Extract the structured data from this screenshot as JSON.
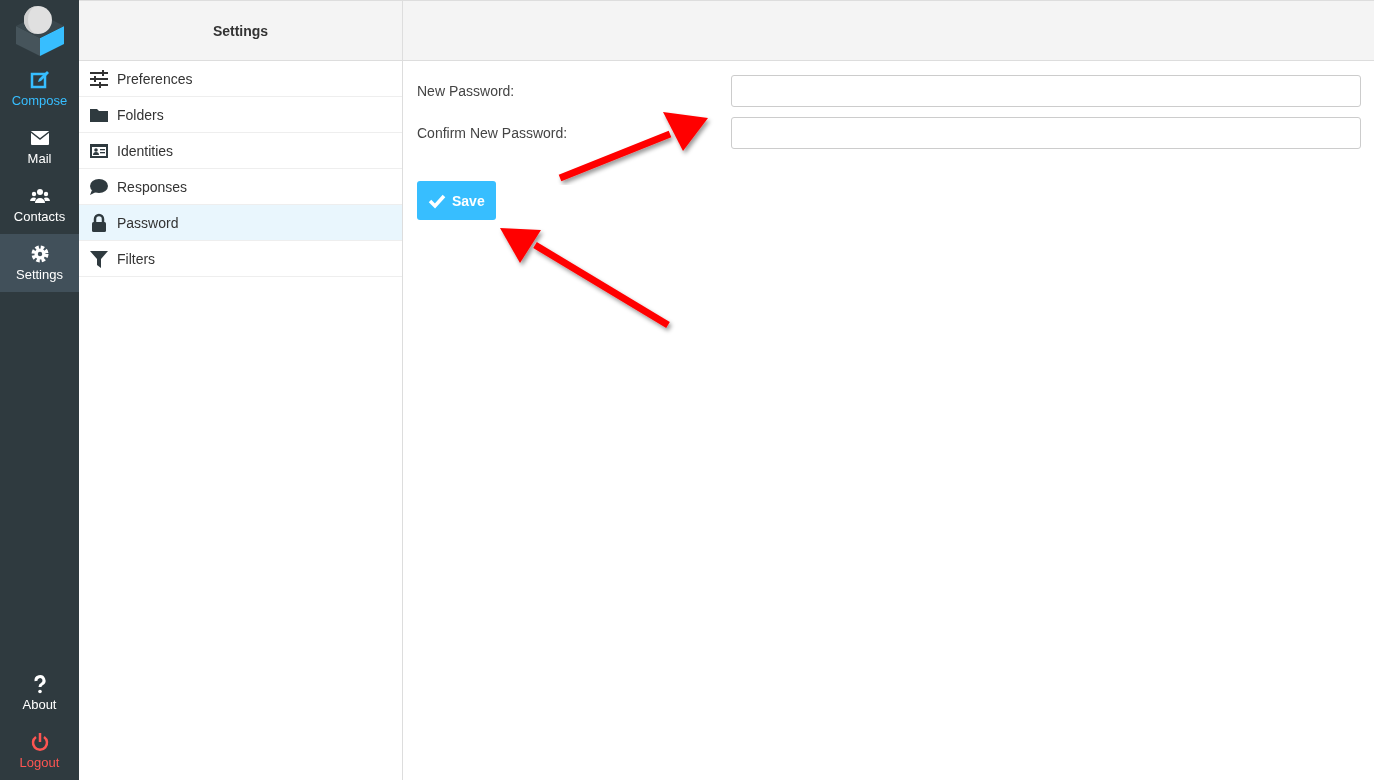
{
  "nav": [
    {
      "label": "Compose",
      "kind": "action",
      "selected": false
    },
    {
      "label": "Mail",
      "kind": "link",
      "selected": false
    },
    {
      "label": "Contacts",
      "kind": "link",
      "selected": false
    },
    {
      "label": "Settings",
      "kind": "link",
      "selected": true
    }
  ],
  "nav_bottom": [
    {
      "label": "About",
      "kind": "link"
    },
    {
      "label": "Logout",
      "kind": "danger"
    }
  ],
  "settings": {
    "title": "Settings",
    "items": [
      {
        "label": "Preferences",
        "selected": false
      },
      {
        "label": "Folders",
        "selected": false
      },
      {
        "label": "Identities",
        "selected": false
      },
      {
        "label": "Responses",
        "selected": false
      },
      {
        "label": "Password",
        "selected": true
      },
      {
        "label": "Filters",
        "selected": false
      }
    ]
  },
  "form": {
    "fields": [
      {
        "label": "New Password:"
      },
      {
        "label": "Confirm New Password:"
      }
    ],
    "save_button": "Save"
  }
}
